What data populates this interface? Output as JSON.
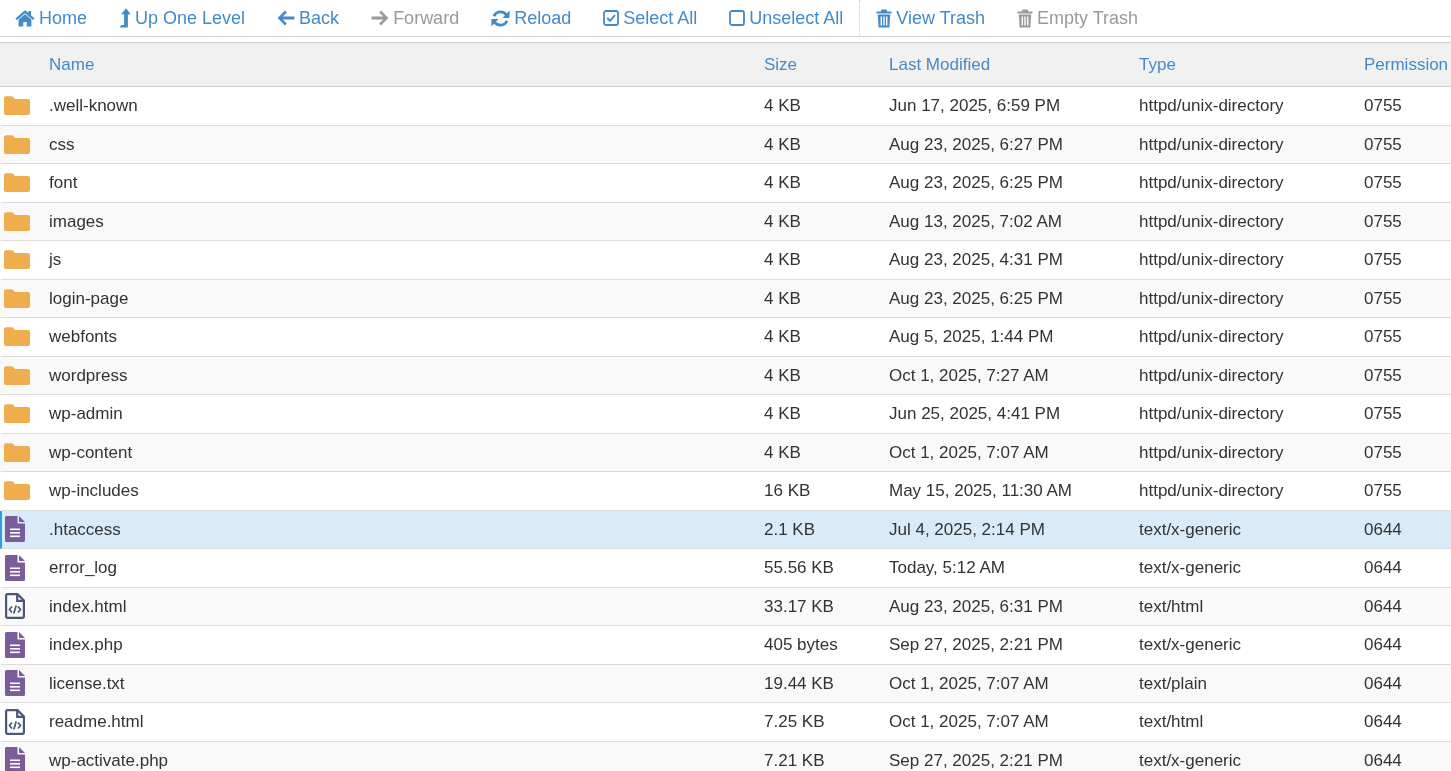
{
  "toolbar": {
    "groups": [
      {
        "buttons": [
          {
            "kind": "home",
            "label": "Home",
            "disabled": false
          },
          {
            "kind": "up-level",
            "label": "Up One Level",
            "disabled": false
          },
          {
            "kind": "back",
            "label": "Back",
            "disabled": false
          },
          {
            "kind": "forward",
            "label": "Forward",
            "disabled": true
          },
          {
            "kind": "reload",
            "label": "Reload",
            "disabled": false
          },
          {
            "kind": "select-all",
            "label": "Select All",
            "disabled": false
          },
          {
            "kind": "unselect-all",
            "label": "Unselect All",
            "disabled": false
          }
        ]
      },
      {
        "buttons": [
          {
            "kind": "view-trash",
            "label": "View Trash",
            "disabled": false
          },
          {
            "kind": "empty-trash",
            "label": "Empty Trash",
            "disabled": true
          }
        ]
      }
    ]
  },
  "table": {
    "columns": [
      "Name",
      "Size",
      "Last Modified",
      "Type",
      "Permission"
    ],
    "rows": [
      {
        "kind": "folder",
        "name": ".well-known",
        "size": "4 KB",
        "modified": "Jun 17, 2025, 6:59 PM",
        "type": "httpd/unix-directory",
        "permission": "0755",
        "selected": false
      },
      {
        "kind": "folder",
        "name": "css",
        "size": "4 KB",
        "modified": "Aug 23, 2025, 6:27 PM",
        "type": "httpd/unix-directory",
        "permission": "0755",
        "selected": false
      },
      {
        "kind": "folder",
        "name": "font",
        "size": "4 KB",
        "modified": "Aug 23, 2025, 6:25 PM",
        "type": "httpd/unix-directory",
        "permission": "0755",
        "selected": false
      },
      {
        "kind": "folder",
        "name": "images",
        "size": "4 KB",
        "modified": "Aug 13, 2025, 7:02 AM",
        "type": "httpd/unix-directory",
        "permission": "0755",
        "selected": false
      },
      {
        "kind": "folder",
        "name": "js",
        "size": "4 KB",
        "modified": "Aug 23, 2025, 4:31 PM",
        "type": "httpd/unix-directory",
        "permission": "0755",
        "selected": false
      },
      {
        "kind": "folder",
        "name": "login-page",
        "size": "4 KB",
        "modified": "Aug 23, 2025, 6:25 PM",
        "type": "httpd/unix-directory",
        "permission": "0755",
        "selected": false
      },
      {
        "kind": "folder",
        "name": "webfonts",
        "size": "4 KB",
        "modified": "Aug 5, 2025, 1:44 PM",
        "type": "httpd/unix-directory",
        "permission": "0755",
        "selected": false
      },
      {
        "kind": "folder",
        "name": "wordpress",
        "size": "4 KB",
        "modified": "Oct 1, 2025, 7:27 AM",
        "type": "httpd/unix-directory",
        "permission": "0755",
        "selected": false
      },
      {
        "kind": "folder",
        "name": "wp-admin",
        "size": "4 KB",
        "modified": "Jun 25, 2025, 4:41 PM",
        "type": "httpd/unix-directory",
        "permission": "0755",
        "selected": false
      },
      {
        "kind": "folder",
        "name": "wp-content",
        "size": "4 KB",
        "modified": "Oct 1, 2025, 7:07 AM",
        "type": "httpd/unix-directory",
        "permission": "0755",
        "selected": false
      },
      {
        "kind": "folder",
        "name": "wp-includes",
        "size": "16 KB",
        "modified": "May 15, 2025, 11:30 AM",
        "type": "httpd/unix-directory",
        "permission": "0755",
        "selected": false
      },
      {
        "kind": "text-file",
        "name": ".htaccess",
        "size": "2.1 KB",
        "modified": "Jul 4, 2025, 2:14 PM",
        "type": "text/x-generic",
        "permission": "0644",
        "selected": true
      },
      {
        "kind": "text-file",
        "name": "error_log",
        "size": "55.56 KB",
        "modified": "Today, 5:12 AM",
        "type": "text/x-generic",
        "permission": "0644",
        "selected": false
      },
      {
        "kind": "code-file",
        "name": "index.html",
        "size": "33.17 KB",
        "modified": "Aug 23, 2025, 6:31 PM",
        "type": "text/html",
        "permission": "0644",
        "selected": false
      },
      {
        "kind": "text-file",
        "name": "index.php",
        "size": "405 bytes",
        "modified": "Sep 27, 2025, 2:21 PM",
        "type": "text/x-generic",
        "permission": "0644",
        "selected": false
      },
      {
        "kind": "text-file",
        "name": "license.txt",
        "size": "19.44 KB",
        "modified": "Oct 1, 2025, 7:07 AM",
        "type": "text/plain",
        "permission": "0644",
        "selected": false
      },
      {
        "kind": "code-file",
        "name": "readme.html",
        "size": "7.25 KB",
        "modified": "Oct 1, 2025, 7:07 AM",
        "type": "text/html",
        "permission": "0644",
        "selected": false
      },
      {
        "kind": "text-file",
        "name": "wp-activate.php",
        "size": "7.21 KB",
        "modified": "Sep 27, 2025, 2:21 PM",
        "type": "text/x-generic",
        "permission": "0644",
        "selected": false
      }
    ]
  }
}
